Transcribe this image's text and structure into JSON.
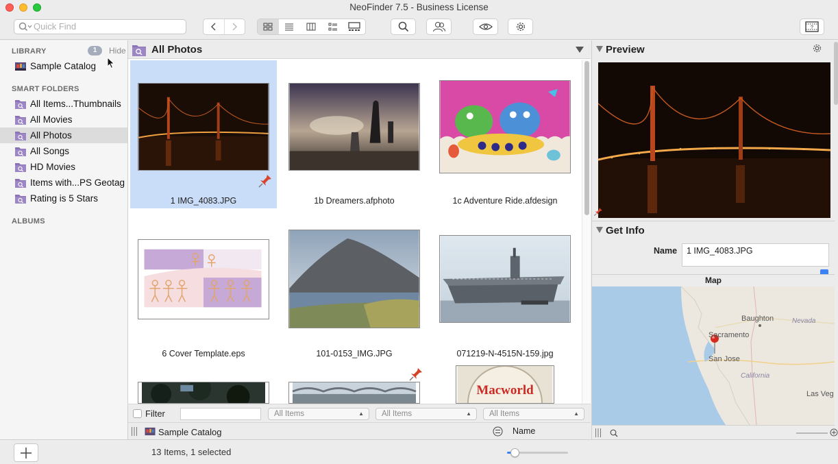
{
  "window": {
    "title": "NeoFinder 7.5 - Business License"
  },
  "toolbar": {
    "search_placeholder": "Quick Find"
  },
  "sidebar": {
    "library_header": "LIBRARY",
    "library_badge": "1",
    "hide_label": "Hide",
    "library_items": [
      {
        "label": "Sample Catalog",
        "icon": "catalog-icon"
      }
    ],
    "smart_folders_header": "SMART FOLDERS",
    "smart_folders": [
      {
        "label": "All Items...Thumbnails"
      },
      {
        "label": "All Movies"
      },
      {
        "label": "All Photos",
        "selected": true
      },
      {
        "label": "All Songs"
      },
      {
        "label": "HD Movies"
      },
      {
        "label": "Items with...PS Geotag"
      },
      {
        "label": "Rating is 5 Stars"
      }
    ],
    "albums_header": "ALBUMS"
  },
  "main": {
    "title": "All Photos",
    "items": [
      {
        "name": "1 IMG_4083.JPG",
        "selected": true,
        "pinned": true
      },
      {
        "name": "1b Dreamers.afphoto"
      },
      {
        "name": "1c Adventure Ride.afdesign"
      },
      {
        "name": "6 Cover Template.eps"
      },
      {
        "name": "101-0153_IMG.JPG",
        "pinned": true
      },
      {
        "name": "071219-N-4515N-159.jpg"
      }
    ],
    "partial_thumb_text": "Macworld",
    "filter_label": "Filter",
    "popups": [
      "All Items",
      "All Items",
      "All Items"
    ],
    "path_label": "Sample Catalog",
    "column_label": "Name"
  },
  "right": {
    "preview_title": "Preview",
    "getinfo_title": "Get Info",
    "name_label": "Name",
    "name_value": "1 IMG_4083.JPG",
    "map_title": "Map",
    "map_places": [
      "Baughton",
      "Sacramento",
      "San Jose",
      "California",
      "Nevada",
      "Las Veg"
    ]
  },
  "status": {
    "text": "13 Items, 1 selected",
    "zoom_level": 0.12
  },
  "colors": {
    "selection": "#c9dcf8",
    "folder_purple": "#8b73b5",
    "pin_red": "#d8432b"
  }
}
